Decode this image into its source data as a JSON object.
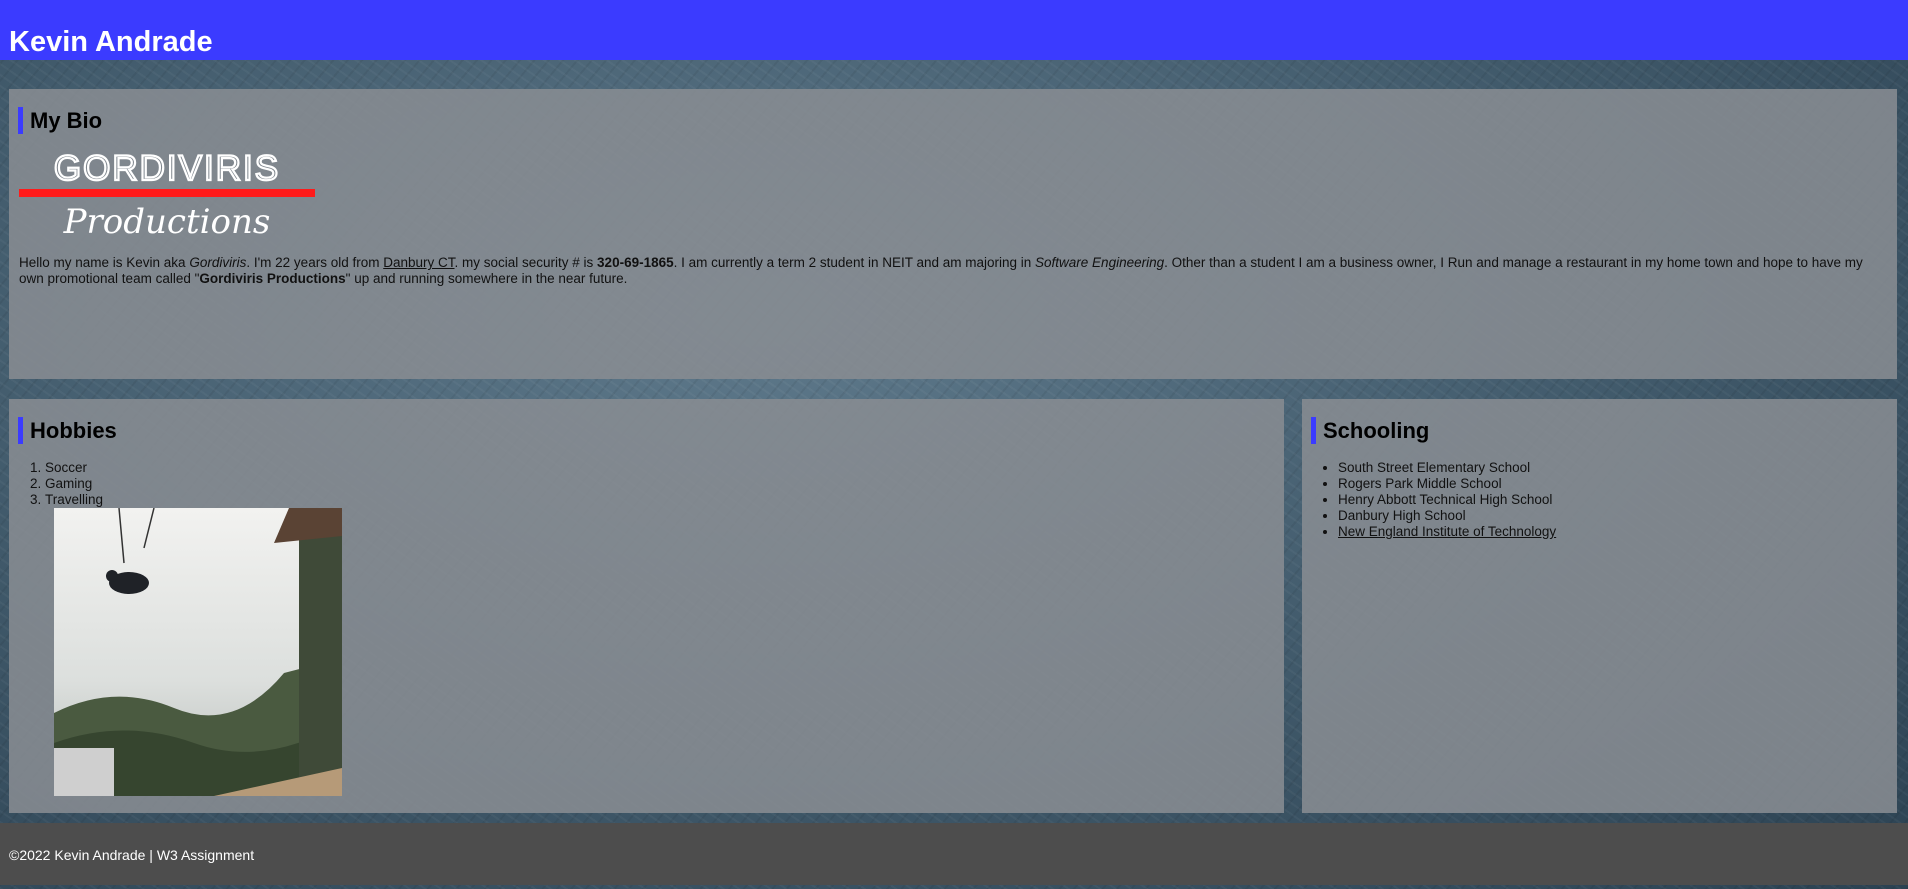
{
  "header": {
    "title": "Kevin Andrade",
    "color": "#3b3bff"
  },
  "bio": {
    "heading": "My Bio",
    "logo": {
      "line1": "GORDIVIRIS",
      "line2": "Productions"
    },
    "text": {
      "p1": "Hello my name is Kevin aka ",
      "alias": "Gordiviris",
      "p2": ". I'm 22 years old from ",
      "hometown": "Danbury CT",
      "p3": ". my social security # is ",
      "ssn": "320-69-1865",
      "p4": ". I am currently a term 2 student in NEIT and am majoring in ",
      "major": "Software Engineering",
      "p5": ". Other than a student I am a business owner, I Run and manage a restaurant in my home town and hope to have my own promotional team called \"",
      "team": "Gordiviris Productions",
      "p6": "\" up and running somewhere in the near future."
    }
  },
  "hobbies": {
    "heading": "Hobbies",
    "items": [
      "Soccer",
      "Gaming",
      "Travelling"
    ]
  },
  "schooling": {
    "heading": "Schooling",
    "items": [
      "South Street Elementary School",
      "Rogers Park Middle School",
      "Henry Abbott Technical High School",
      "Danbury High School",
      "New England Institute of Technology"
    ]
  },
  "footer": {
    "text": "©2022 Kevin Andrade | W3 Assignment"
  }
}
